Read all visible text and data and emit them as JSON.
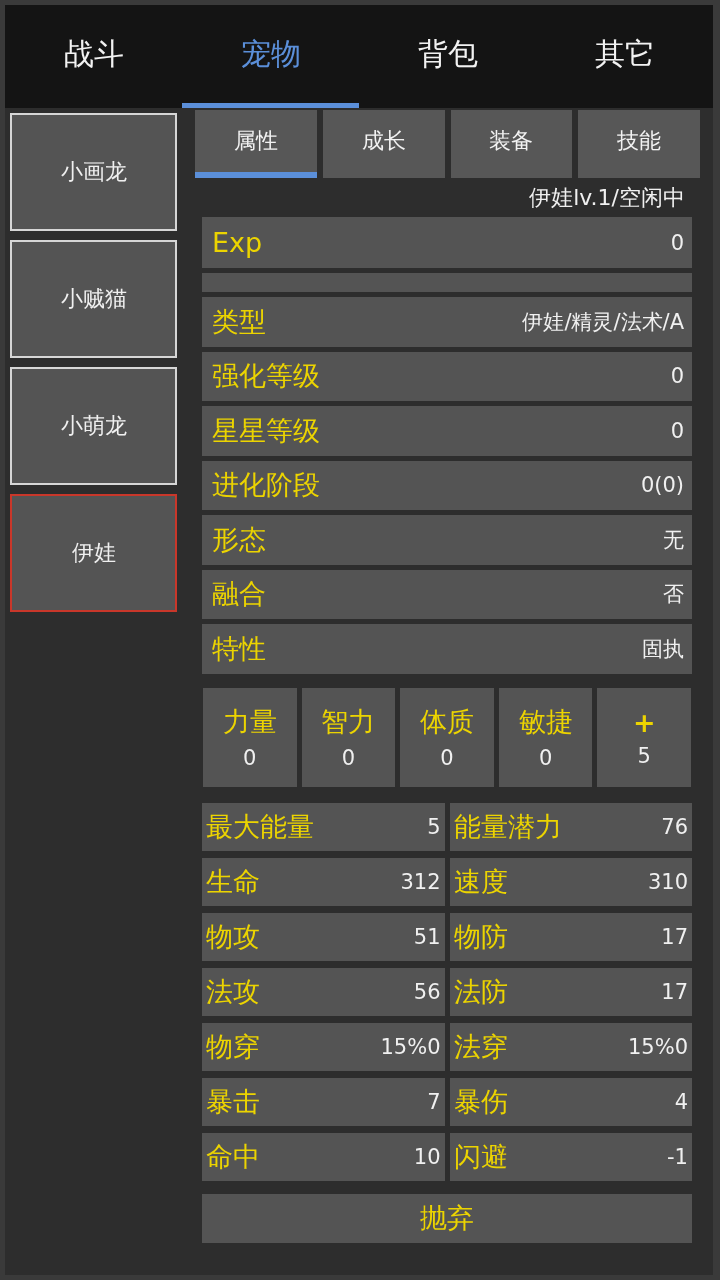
{
  "top_tabs": [
    {
      "label": "战斗",
      "selected": false
    },
    {
      "label": "宠物",
      "selected": true
    },
    {
      "label": "背包",
      "selected": false
    },
    {
      "label": "其它",
      "selected": false
    }
  ],
  "pet_list": [
    {
      "name": "小画龙",
      "selected": false
    },
    {
      "name": "小贼猫",
      "selected": false
    },
    {
      "name": "小萌龙",
      "selected": false
    },
    {
      "name": "伊娃",
      "selected": true
    }
  ],
  "sub_tabs": [
    {
      "label": "属性",
      "selected": true
    },
    {
      "label": "成长",
      "selected": false
    },
    {
      "label": "装备",
      "selected": false
    },
    {
      "label": "技能",
      "selected": false
    }
  ],
  "status": "伊娃lv.1/空闲中",
  "info_rows": [
    {
      "kind": "field",
      "label": "Exp",
      "value": "0"
    },
    {
      "kind": "blank"
    },
    {
      "kind": "field",
      "label": "类型",
      "value": "伊娃/精灵/法术/A"
    },
    {
      "kind": "field",
      "label": "强化等级",
      "value": "0"
    },
    {
      "kind": "field",
      "label": "星星等级",
      "value": "0"
    },
    {
      "kind": "field",
      "label": "进化阶段",
      "value": "0(0)"
    },
    {
      "kind": "field",
      "label": "形态",
      "value": "无"
    },
    {
      "kind": "field",
      "label": "融合",
      "value": "否"
    },
    {
      "kind": "field",
      "label": "特性",
      "value": "固执"
    }
  ],
  "attributes": [
    {
      "label": "力量",
      "value": "0"
    },
    {
      "label": "智力",
      "value": "0"
    },
    {
      "label": "体质",
      "value": "0"
    },
    {
      "label": "敏捷",
      "value": "0"
    }
  ],
  "points_button": {
    "label": "+",
    "value": "5"
  },
  "stats": [
    {
      "label": "最大能量",
      "value": "5"
    },
    {
      "label": "能量潜力",
      "value": "76"
    },
    {
      "label": "生命",
      "value": "312"
    },
    {
      "label": "速度",
      "value": "310"
    },
    {
      "label": "物攻",
      "value": "51"
    },
    {
      "label": "物防",
      "value": "17"
    },
    {
      "label": "法攻",
      "value": "56"
    },
    {
      "label": "法防",
      "value": "17"
    },
    {
      "label": "物穿",
      "value": "15%0"
    },
    {
      "label": "法穿",
      "value": "15%0"
    },
    {
      "label": "暴击",
      "value": "7"
    },
    {
      "label": "暴伤",
      "value": "4"
    },
    {
      "label": "命中",
      "value": "10"
    },
    {
      "label": "闪避",
      "value": "-1"
    }
  ],
  "abandon_button": "抛弃"
}
